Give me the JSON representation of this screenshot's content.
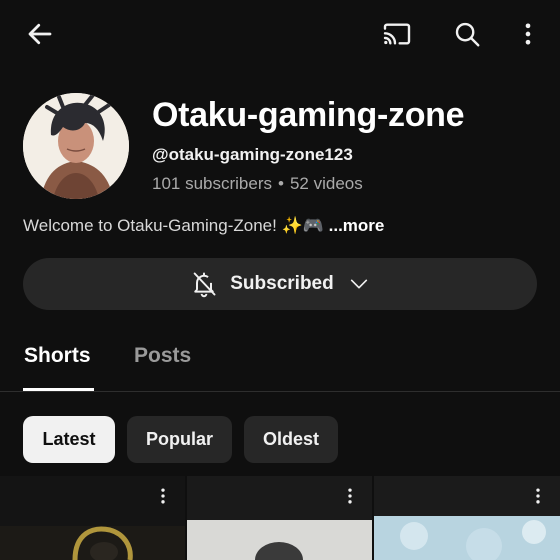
{
  "topbar": {
    "back_icon": "arrow-left-icon",
    "cast_icon": "cast-icon",
    "search_icon": "search-icon",
    "more_icon": "more-vertical-icon"
  },
  "channel": {
    "title": "Otaku-gaming-zone",
    "handle": "@otaku-gaming-zone123",
    "subscribers": "101 subscribers",
    "separator": "•",
    "videos": "52 videos",
    "description": "Welcome to Otaku-Gaming-Zone! ✨🎮",
    "more_link": "...more"
  },
  "subscribe_button": {
    "label": "Subscribed",
    "bell_icon": "bell-off-icon",
    "chevron_icon": "chevron-down-icon"
  },
  "tabs": [
    {
      "label": "Shorts",
      "selected": true
    },
    {
      "label": "Posts",
      "selected": false
    }
  ],
  "filters": [
    {
      "label": "Latest",
      "selected": true
    },
    {
      "label": "Popular",
      "selected": false
    },
    {
      "label": "Oldest",
      "selected": false
    }
  ],
  "colors": {
    "background": "#0f0f0f",
    "surface": "#272727",
    "text_primary": "#f1f1f1",
    "text_secondary": "#aaaaaa",
    "chip_selected": "#f1f1f1"
  }
}
